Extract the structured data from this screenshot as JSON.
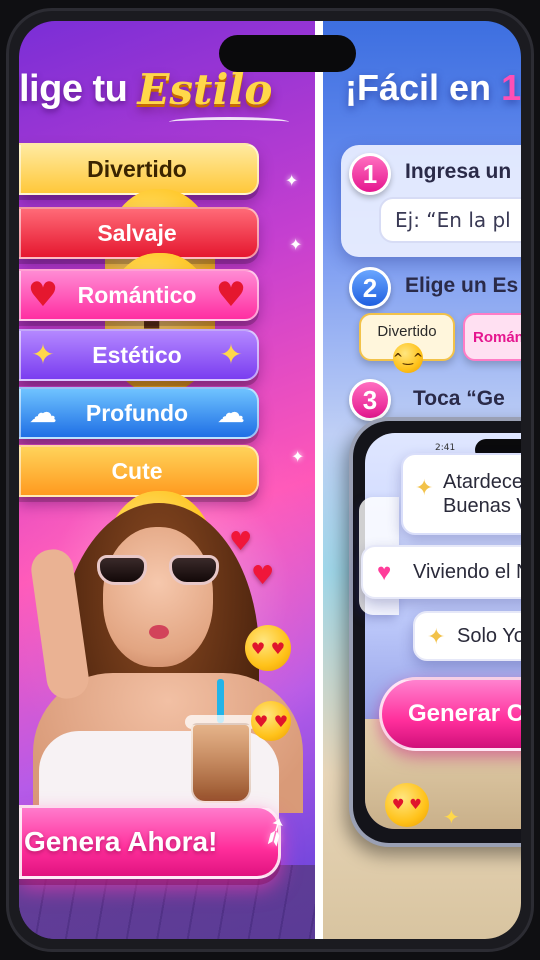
{
  "left_panel": {
    "title_plain": "lige tu",
    "title_script": "Estilo",
    "styles": [
      {
        "label": "Divertido",
        "icon": "laughing-face-icon",
        "glyph": "😂"
      },
      {
        "label": "Salvaje",
        "icon": "sunglasses-face-icon",
        "glyph": "😎"
      },
      {
        "label": "Romántico",
        "icon": "red-heart-icon",
        "glyph": "❤"
      },
      {
        "label": "Estético",
        "icon": "sparkles-icon",
        "glyph": "✨"
      },
      {
        "label": "Profundo",
        "icon": "thought-cloud-icon",
        "glyph": "☁"
      },
      {
        "label": "Cute",
        "icon": "smiling-eyes-face-icon",
        "glyph": "🥰"
      }
    ],
    "cta_label": "Genera Ahora!",
    "cta_icon": "rocket-icon"
  },
  "right_panel": {
    "title_plain": "¡Fácil en",
    "title_accent": "1",
    "steps": [
      {
        "number": "1",
        "text": "Ingresa un"
      },
      {
        "number": "2",
        "text": "Elige un Es"
      },
      {
        "number": "3",
        "text": "Toca “Ge"
      }
    ],
    "input_placeholder": "Ej: “En la pl",
    "chips": [
      "Divertido",
      "Románt"
    ],
    "inner_phone": {
      "time": "2:41",
      "captions": [
        {
          "line1": "Atardece",
          "line2": "Buenas V",
          "icon": "sparkle-icon"
        },
        {
          "line1": "Viviendo el N",
          "icon": "pink-heart-icon"
        },
        {
          "line1": "Solo Yo &",
          "icon": "sparkle-icon"
        }
      ],
      "generate_label": "Generar C"
    }
  },
  "colors": {
    "accent_pink": "#ff2e9b",
    "accent_yellow": "#ffd84a",
    "step_blue": "#1f5fe0"
  }
}
